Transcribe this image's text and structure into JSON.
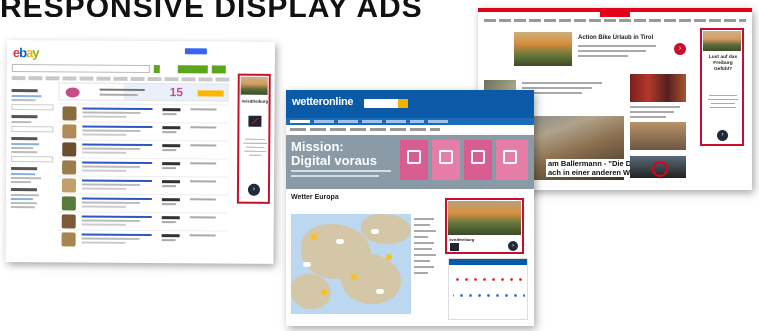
{
  "headline": "RESPONSIVE DISPLAY ADS",
  "ebay": {
    "logo": {
      "e": "e",
      "b": "b",
      "a": "a",
      "y": "y"
    },
    "banner_percent": "15",
    "ad": {
      "tag": "#visitfreiburg",
      "cta": "›"
    }
  },
  "wetter": {
    "logo": "wetteronline",
    "mission_line1": "Mission:",
    "mission_line2": "Digital voraus",
    "map_title": "Wetter Europa",
    "ad": {
      "tag": "#visitfreiburg",
      "cta": "›"
    }
  },
  "news": {
    "top_ad": {
      "title": "Action Bike Urlaub in Tirol",
      "cta": "›"
    },
    "side_ad": {
      "title": "Lust auf das Freiburg Gefühl?",
      "cta": "›"
    },
    "headline_line1": "am Ballermann - \"Die Deutschen",
    "headline_line2": "ach in einer anderen Welt\""
  },
  "colors": {
    "ad_border": "#c8102e",
    "wetter_blue": "#0b5aa8",
    "news_red": "#e2001a",
    "mission_pink": "#d95c93"
  }
}
